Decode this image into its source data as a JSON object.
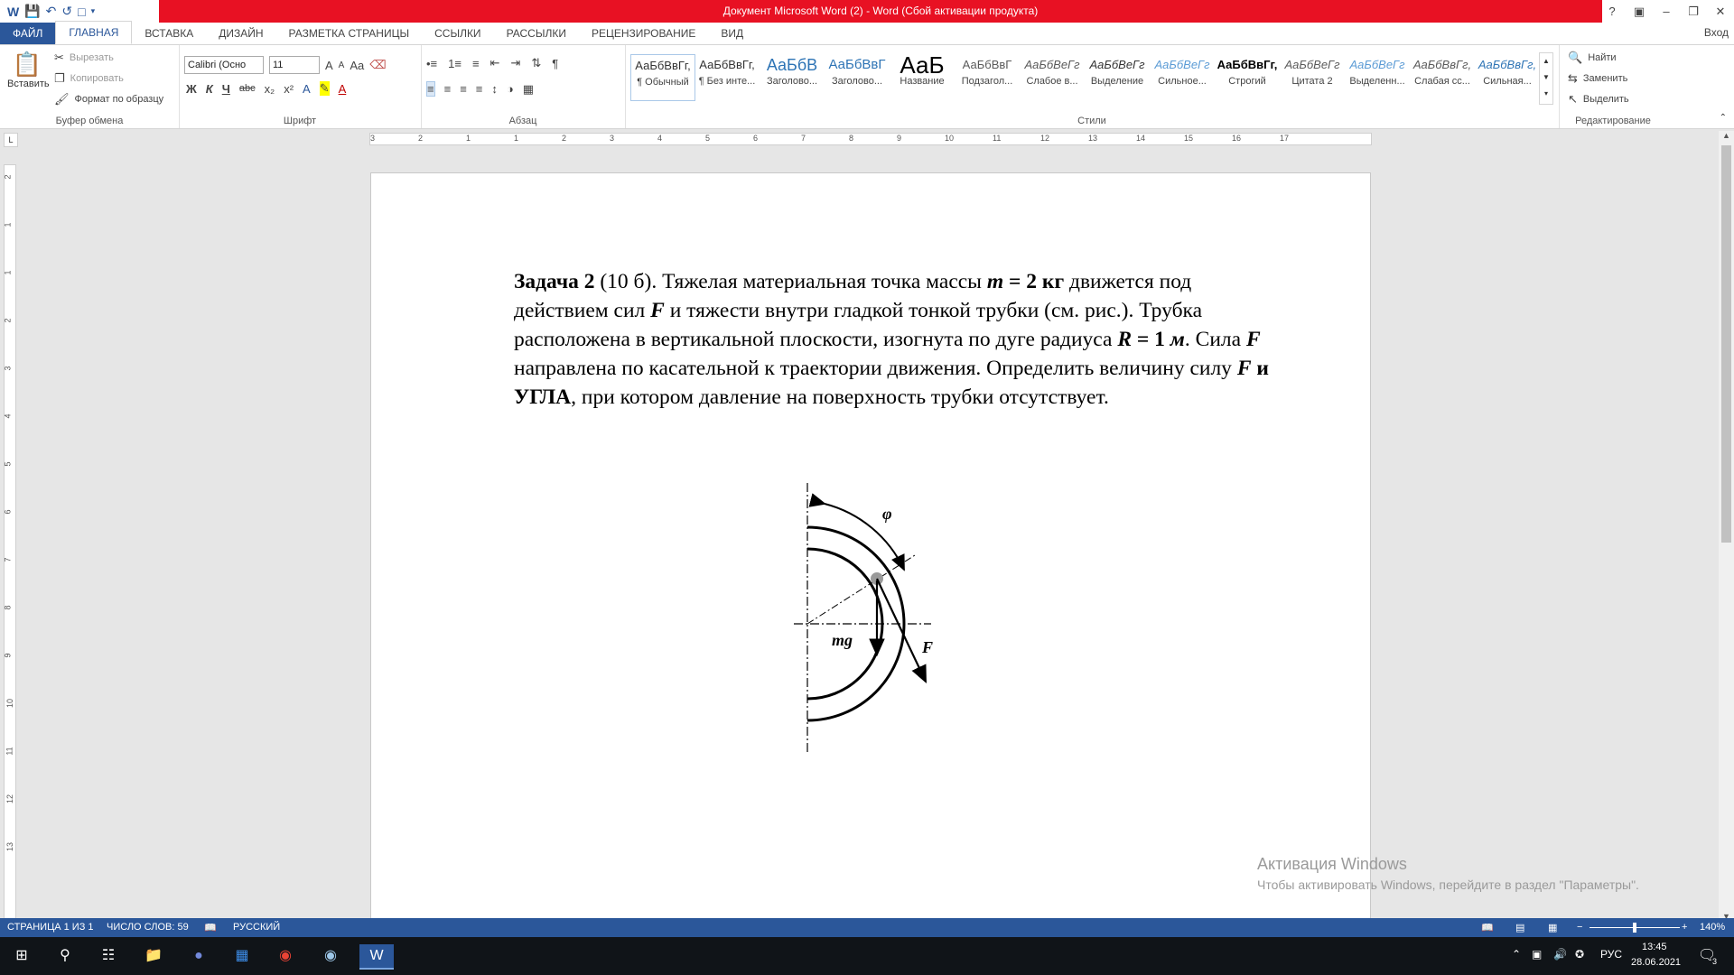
{
  "window": {
    "title": "Документ Microsoft Word (2) -  Word (Сбой активации продукта)",
    "sign_in": "Вход"
  },
  "tabs": [
    "ФАЙЛ",
    "ГЛАВНАЯ",
    "ВСТАВКА",
    "ДИЗАЙН",
    "РАЗМЕТКА СТРАНИЦЫ",
    "ССЫЛКИ",
    "РАССЫЛКИ",
    "РЕЦЕНЗИРОВАНИЕ",
    "ВИД"
  ],
  "ribbon": {
    "clipboard": {
      "label": "Буфер обмена",
      "paste": "Вставить",
      "cut": "Вырезать",
      "copy": "Копировать",
      "format_painter": "Формат по образцу"
    },
    "font": {
      "label": "Шрифт",
      "font_name": "Calibri (Осно",
      "font_size": "11",
      "bold": "Ж",
      "italic": "К",
      "underline": "Ч",
      "strike": "abc",
      "subscript": "x₂",
      "superscript": "x²",
      "grow": "A",
      "shrink": "A",
      "case": "Aa"
    },
    "paragraph": {
      "label": "Абзац"
    },
    "styles": {
      "label": "Стили",
      "items": [
        {
          "sample": "АаБбВвГг,",
          "name": "¶ Обычный"
        },
        {
          "sample": "АаБбВвГг,",
          "name": "¶ Без инте..."
        },
        {
          "sample": "АаБбВ",
          "name": "Заголово..."
        },
        {
          "sample": "АаБбВвГ",
          "name": "Заголово..."
        },
        {
          "sample": "АаБ",
          "name": "Название"
        },
        {
          "sample": "АаБбВвГ",
          "name": "Подзагол..."
        },
        {
          "sample": "АаБбВеГг",
          "name": "Слабое в..."
        },
        {
          "sample": "АаБбВеГг",
          "name": "Выделение"
        },
        {
          "sample": "АаБбВеГг",
          "name": "Сильное..."
        },
        {
          "sample": "АаБбВвГг,",
          "name": "Строгий"
        },
        {
          "sample": "АаБбВеГг",
          "name": "Цитата 2"
        },
        {
          "sample": "АаБбВеГг",
          "name": "Выделенн..."
        },
        {
          "sample": "АаБбВвГг,",
          "name": "Слабая сс..."
        },
        {
          "sample": "АаБбВвГг,",
          "name": "Сильная..."
        }
      ]
    },
    "editing": {
      "label": "Редактирование",
      "find": "Найти",
      "replace": "Заменить",
      "select": "Выделить"
    }
  },
  "ruler": {
    "h_ticks": [
      "3",
      "2",
      "1",
      "1",
      "2",
      "3",
      "4",
      "5",
      "6",
      "7",
      "8",
      "9",
      "10",
      "11",
      "12",
      "13",
      "14",
      "15",
      "16",
      "17"
    ],
    "v_ticks": [
      "2",
      "1",
      "1",
      "2",
      "3",
      "4",
      "5",
      "6",
      "7",
      "8",
      "9",
      "10",
      "11",
      "12",
      "13"
    ]
  },
  "document": {
    "t1": "Задача 2",
    "t2": " (10 б). Тяжелая материальная точка массы ",
    "t3": "m",
    "t4": " = 2 кг",
    "t5": " движется под действием сил ",
    "t6": "F",
    "t7": " и тяжести внутри гладкой тонкой трубки (см. рис.). Трубка расположена в вертикальной плоскости, изогнута по дуге радиуса ",
    "t8": "R",
    "t9": " = 1 ",
    "t10": "м",
    "t11": ". Сила ",
    "t12": "F",
    "t13": " направлена по касательной к траектории движения. Определить величину силу ",
    "t14": "F",
    "t15": " и УГЛА",
    "t16": ", при котором давление на поверхность трубки отсутствует.",
    "figure": {
      "label_phi": "φ",
      "label_mg": "mg",
      "label_F": "F"
    }
  },
  "activation": {
    "title": "Активация Windows",
    "subtitle": "Чтобы активировать Windows, перейдите в раздел \"Параметры\"."
  },
  "status": {
    "page": "СТРАНИЦА 1 ИЗ 1",
    "words": "ЧИСЛО СЛОВ: 59",
    "lang": "РУССКИЙ",
    "zoom": "140%"
  },
  "taskbar": {
    "lang": "РУС",
    "time": "13:45",
    "date": "28.06.2021",
    "notifications": "3"
  }
}
